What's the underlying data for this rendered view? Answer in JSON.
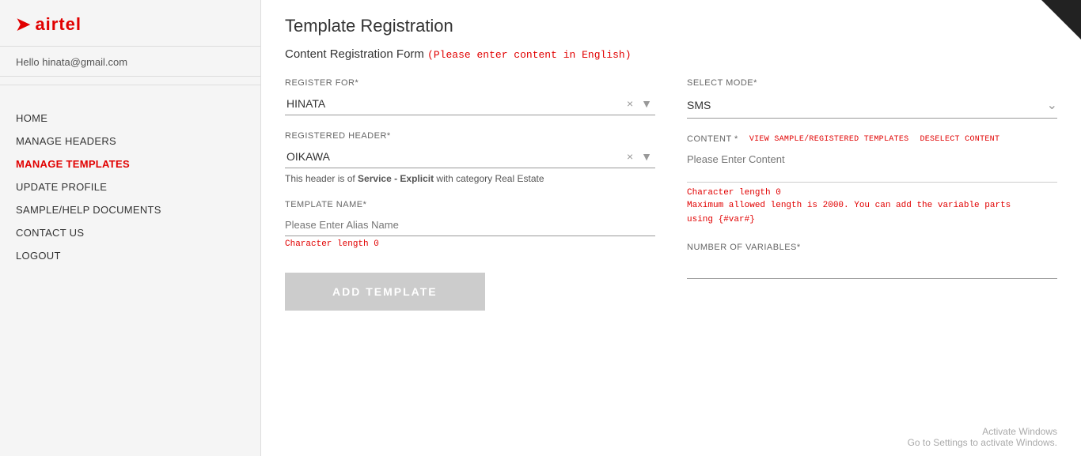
{
  "logo": {
    "icon": "✈",
    "brand": "airtel"
  },
  "hello": {
    "greeting": "Hello",
    "email": "hinata@gmail.com"
  },
  "nav": {
    "items": [
      {
        "id": "home",
        "label": "HOME",
        "active": false
      },
      {
        "id": "manage-headers",
        "label": "MANAGE HEADERS",
        "active": false
      },
      {
        "id": "manage-templates",
        "label": "MANAGE TEMPLATES",
        "active": true
      },
      {
        "id": "update-profile",
        "label": "UPDATE PROFILE",
        "active": false
      },
      {
        "id": "sample-help",
        "label": "SAMPLE/HELP DOCUMENTS",
        "active": false
      },
      {
        "id": "contact-us",
        "label": "CONTACT US",
        "active": false
      },
      {
        "id": "logout",
        "label": "LOGOUT",
        "active": false
      }
    ]
  },
  "page": {
    "title": "Template Registration",
    "subtitle": "Content Registration Form",
    "subtitle_note": "(Please enter content in English)"
  },
  "form": {
    "register_for_label": "REGISTER FOR*",
    "register_for_value": "HINATA",
    "registered_header_label": "REGISTERED HEADER*",
    "registered_header_value": "OIKAWA",
    "header_note_prefix": "This header is of ",
    "header_note_type": "Service - Explicit",
    "header_note_suffix": " with category Real Estate",
    "template_name_label": "TEMPLATE NAME*",
    "template_name_placeholder": "Please Enter Alias Name",
    "template_name_char": "Character length 0",
    "select_mode_label": "SELECT MODE*",
    "select_mode_value": "SMS",
    "content_label": "CONTENT *",
    "view_sample_link": "VIEW SAMPLE/REGISTERED TEMPLATES",
    "deselect_link": "DESELECT CONTENT",
    "content_placeholder": "Please Enter Content",
    "content_char": "Character length 0",
    "content_limit_note": "Maximum allowed length is 2000. You can add the variable parts",
    "content_limit_note2": "using {#var#}",
    "number_of_variables_label": "NUMBER OF VARIABLES*",
    "add_template_btn": "ADD TEMPLATE"
  },
  "activate_windows": {
    "line1": "Activate Windows",
    "line2": "Go to Settings to activate Windows."
  }
}
